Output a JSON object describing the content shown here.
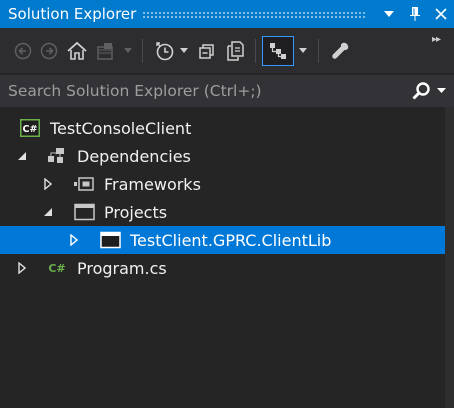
{
  "window": {
    "title": "Solution Explorer",
    "title_icons": [
      "dropdown-arrow-icon",
      "pin-icon",
      "close-icon"
    ]
  },
  "toolbar": {
    "buttons": [
      "back-icon",
      "forward-icon",
      "home-icon",
      "switch-views-icon",
      "pending-changes-filter-icon",
      "collapse-all-icon",
      "show-all-files-icon",
      "sync-active-document-icon",
      "properties-icon"
    ]
  },
  "search": {
    "placeholder": "Search Solution Explorer (Ctrl+;)"
  },
  "tree": {
    "items": [
      {
        "label": "TestConsoleClient",
        "icon": "csharp-project-icon",
        "expanded": null,
        "depth": 0
      },
      {
        "label": "Dependencies",
        "icon": "dependencies-icon",
        "expanded": true,
        "depth": 1
      },
      {
        "label": "Frameworks",
        "icon": "frameworks-icon",
        "expanded": false,
        "depth": 2
      },
      {
        "label": "Projects",
        "icon": "projects-icon",
        "expanded": true,
        "depth": 2
      },
      {
        "label": "TestClient.GPRC.ClientLib",
        "icon": "project-reference-icon",
        "expanded": false,
        "depth": 3,
        "selected": true
      },
      {
        "label": "Program.cs",
        "icon": "csharp-file-icon",
        "expanded": false,
        "depth": 1
      }
    ]
  },
  "colors": {
    "accent": "#007acc",
    "selection": "#0078d7",
    "background": "#252526",
    "csharp_green": "#6ab04c"
  }
}
